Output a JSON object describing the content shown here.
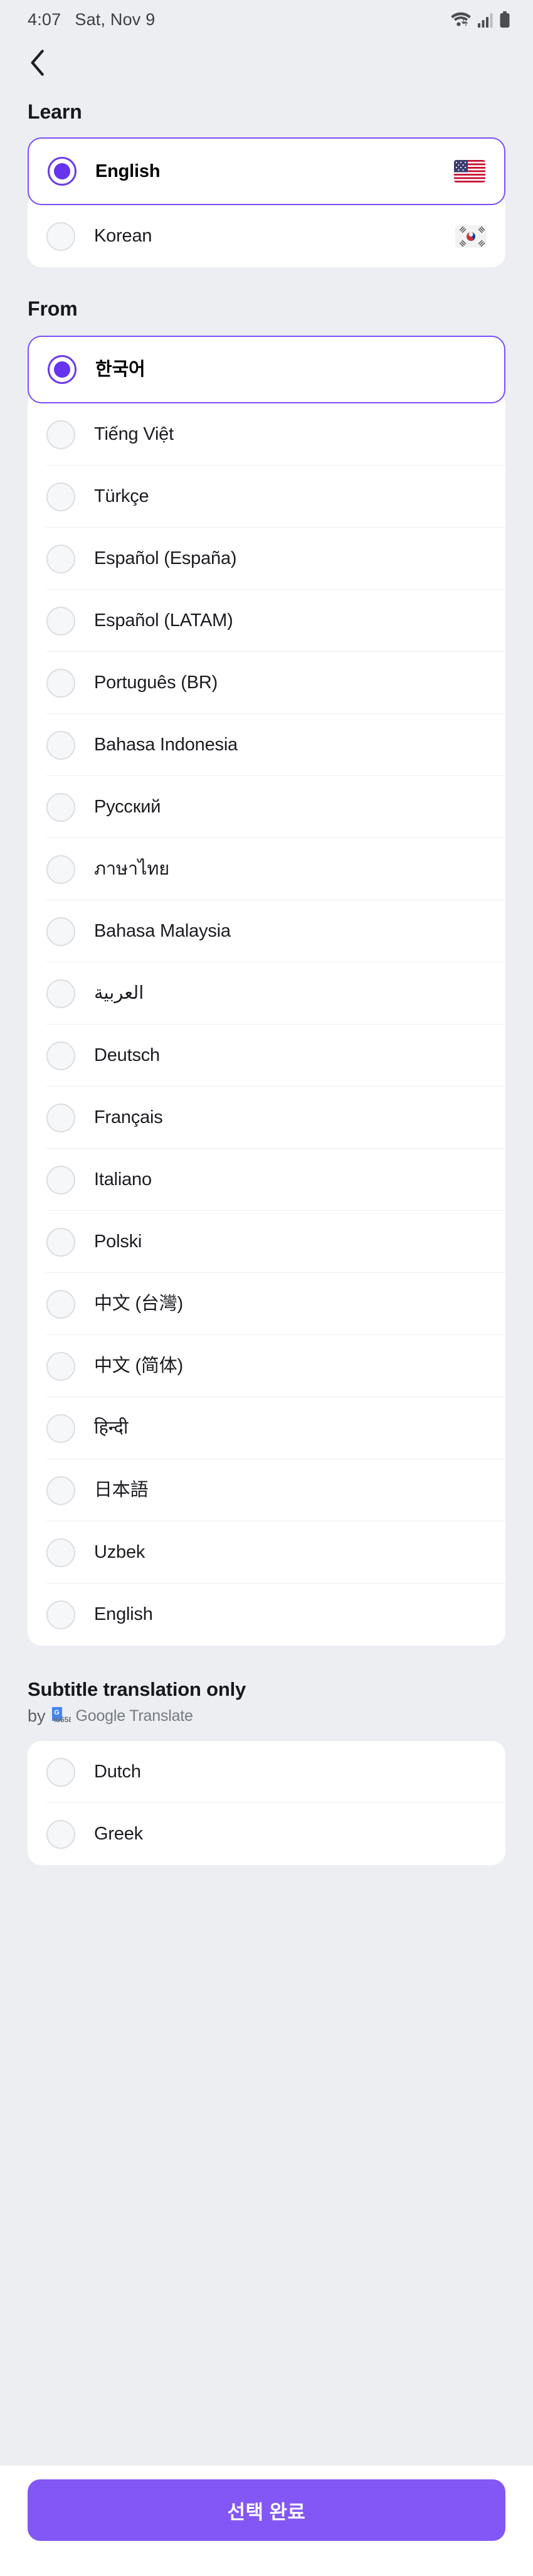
{
  "status_bar": {
    "time": "4:07",
    "date": "Sat, Nov 9",
    "icons": [
      "wifi-icon",
      "signal-icon",
      "battery-icon"
    ]
  },
  "nav": {
    "back_label": "back-arrow"
  },
  "learn": {
    "title": "Learn",
    "options": [
      {
        "label": "English",
        "selected": true,
        "flag": "us-flag"
      },
      {
        "label": "Korean",
        "selected": false,
        "flag": "kr-flag"
      }
    ]
  },
  "from": {
    "title": "From",
    "selected_option": {
      "label": "한국어",
      "selected": true
    },
    "options": [
      {
        "label": "Tiếng Việt",
        "selected": false
      },
      {
        "label": "Türkçe",
        "selected": false
      },
      {
        "label": "Español (España)",
        "selected": false
      },
      {
        "label": "Español (LATAM)",
        "selected": false
      },
      {
        "label": "Português (BR)",
        "selected": false
      },
      {
        "label": "Bahasa Indonesia",
        "selected": false
      },
      {
        "label": "Русский",
        "selected": false
      },
      {
        "label": "ภาษาไทย",
        "selected": false
      },
      {
        "label": "Bahasa Malaysia",
        "selected": false
      },
      {
        "label": "العربية",
        "selected": false
      },
      {
        "label": "Deutsch",
        "selected": false
      },
      {
        "label": "Français",
        "selected": false
      },
      {
        "label": "Italiano",
        "selected": false
      },
      {
        "label": "Polski",
        "selected": false
      },
      {
        "label": "中文 (台灣)",
        "selected": false
      },
      {
        "label": "中文 (简体)",
        "selected": false
      },
      {
        "label": "हिन्दी",
        "selected": false
      },
      {
        "label": "日本語",
        "selected": false
      },
      {
        "label": "Uzbek",
        "selected": false
      },
      {
        "label": "English",
        "selected": false
      }
    ]
  },
  "subtitle_only": {
    "title": "Subtitle translation only",
    "by_text": "by",
    "provider": "Google Translate",
    "provider_icon": "google-translate-icon",
    "options": [
      {
        "label": "Dutch",
        "selected": false
      },
      {
        "label": "Greek",
        "selected": false
      }
    ]
  },
  "cta": {
    "label": "선택 완료"
  },
  "colors": {
    "accent": "#6633ee",
    "accent_border": "#7c4dff",
    "cta_bg": "#8257f5",
    "page_bg": "#eceef2",
    "card_bg": "#ffffff"
  }
}
